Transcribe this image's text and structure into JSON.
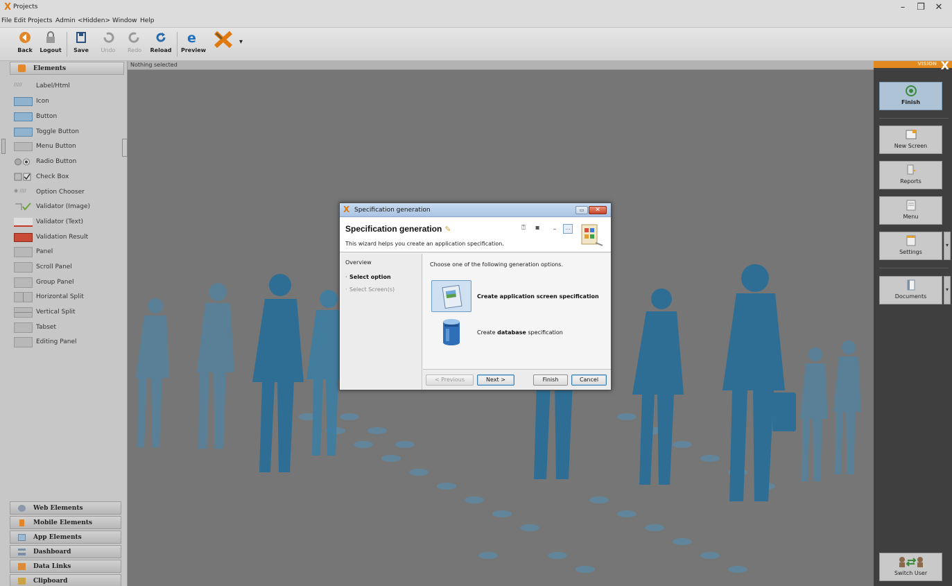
{
  "window": {
    "title": "Projects",
    "controls": {
      "minimize": "–",
      "restore": "❐",
      "close": "✕"
    }
  },
  "menu": [
    "File",
    "Edit",
    "Projects",
    "Admin",
    "<Hidden>",
    "Window",
    "Help"
  ],
  "toolbar": {
    "back": "Back",
    "logout": "Logout",
    "save": "Save",
    "undo": "Undo",
    "redo": "Redo",
    "reload": "Reload",
    "preview": "Preview",
    "dropdown_glyph": "▾"
  },
  "palette": {
    "header": "Elements",
    "items": [
      "Label/Html",
      "Icon",
      "Button",
      "Toggle Button",
      "Menu Button",
      "Radio Button",
      "Check Box",
      "Option Chooser",
      "Validator (Image)",
      "Validator (Text)",
      "Validation Result",
      "Panel",
      "Scroll Panel",
      "Group Panel",
      "Horizontal Split",
      "Vertical Split",
      "Tabset",
      "Editing Panel"
    ],
    "categories": [
      "Web Elements",
      "Mobile Elements",
      "App Elements",
      "Dashboard",
      "Data Links",
      "Clipboard"
    ]
  },
  "canvas": {
    "status": "Nothing selected"
  },
  "right_panel": {
    "brand": "VISION",
    "brand_x": "X",
    "finish": "Finish",
    "new_screen": "New Screen",
    "reports": "Reports",
    "menu": "Menu",
    "settings": "Settings",
    "documents": "Documents",
    "switch_user": "Switch User",
    "dropdown_glyph": "▾"
  },
  "dialog": {
    "title": "Specification generation",
    "heading": "Specification generation",
    "subtitle": "This wizard helps you create an application specification.",
    "overview": "Overview",
    "steps": [
      "Select option",
      "Select Screen(s)"
    ],
    "prompt": "Choose one of the following generation options.",
    "option1": "Create application screen specification",
    "option2_pre": "Create ",
    "option2_bold": "database",
    "option2_post": " specification",
    "buttons": {
      "previous": "< Previous",
      "next": "Next >",
      "finish": "Finish",
      "cancel": "Cancel"
    }
  },
  "colors": {
    "accent": "#e28a1f",
    "dialog_title": "#b7cfea",
    "selection": "#cfe0f2",
    "silhouette": "#2f6e94"
  }
}
